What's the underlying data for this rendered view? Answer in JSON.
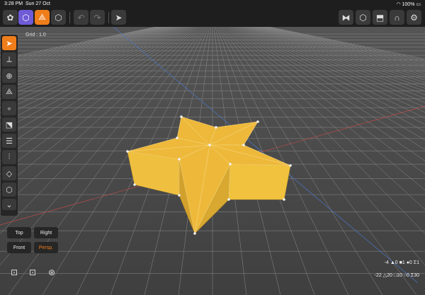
{
  "status": {
    "time": "3:28 PM",
    "date": "Sun 27 Oct",
    "battery": "100%"
  },
  "grid_label": "Grid : 1.0",
  "views": {
    "top": "Top",
    "right": "Right",
    "front": "Front",
    "persp": "Persp."
  },
  "stats": {
    "line1": "-4 ▲0 ■1 ●0 Σ1",
    "line2": "-22 △20 □10 ○0 Σ30"
  },
  "icons": {
    "toolbar_left": [
      "scene-objects-icon",
      "cube-mode-icon",
      "vertex-mode-icon",
      "object-mode-icon",
      "undo-icon",
      "redo-icon",
      "pointer-icon"
    ],
    "toolbar_right": [
      "mirror-icon",
      "box-view-icon",
      "export-icon",
      "magnet-icon",
      "settings-icon"
    ],
    "sidebar": [
      "select-icon",
      "move-icon",
      "rotate-icon",
      "scale-icon",
      "extrude-icon",
      "edit-face-icon",
      "align-icon",
      "split-icon",
      "bevel-icon",
      "cube-add-icon",
      "more-icon"
    ],
    "camera": [
      "camera-focus-icon",
      "camera-frame-icon",
      "camera-reset-icon"
    ]
  },
  "colors": {
    "accent": "#ef7d1a",
    "selection": "#6f5bd6",
    "mesh": "#eebf3c",
    "background": "#4a4a4a"
  }
}
